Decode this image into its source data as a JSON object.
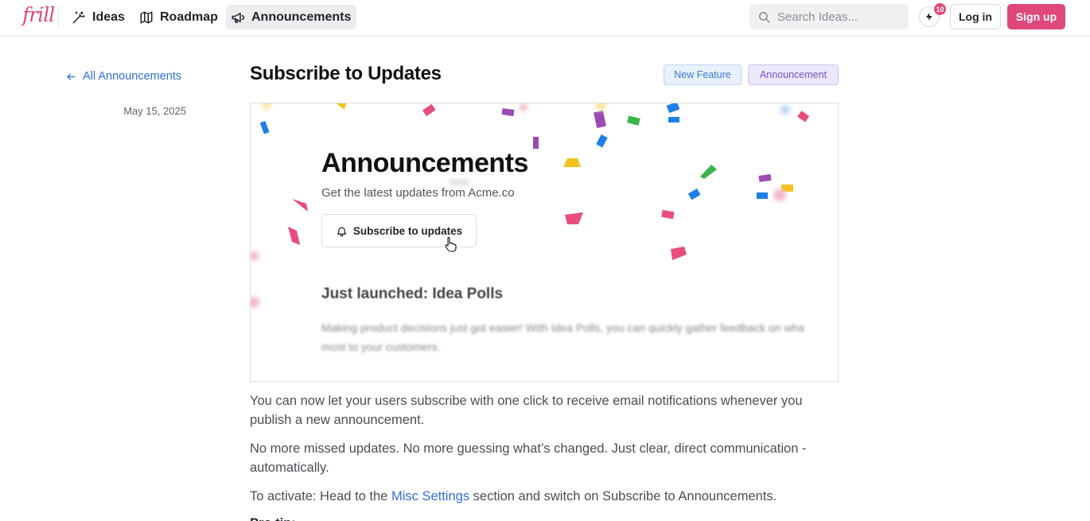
{
  "brand": {
    "logo_text": "frill",
    "accent_color": "#e0477a",
    "link_color": "#2f6fdb"
  },
  "nav": {
    "items": [
      {
        "label": "Ideas",
        "icon": "magic-wand-icon"
      },
      {
        "label": "Roadmap",
        "icon": "map-icon"
      },
      {
        "label": "Announcements",
        "icon": "megaphone-icon",
        "active": true
      }
    ]
  },
  "search": {
    "placeholder": "Search Ideas..."
  },
  "notifications": {
    "count": "10",
    "icon": "lightning-icon"
  },
  "auth": {
    "login_label": "Log in",
    "signup_label": "Sign up"
  },
  "sidebar": {
    "back_label": "All Announcements",
    "date": "May 15, 2025"
  },
  "post": {
    "title": "Subscribe to Updates",
    "tags": [
      {
        "label": "New Feature",
        "color": "#3d7cd1"
      },
      {
        "label": "Announcement",
        "color": "#7654c9"
      }
    ],
    "hero": {
      "title": "Announcements",
      "subtitle": "Get the latest updates from Acme.co",
      "button_label": "Subscribe to updates",
      "section_title": "Just launched: Idea Polls",
      "section_text_1": "Making product decisions just got easier! With Idea Polls, you can quickly gather feedback on wha",
      "section_text_2": "most to your customers."
    },
    "paragraph_1": "You can now let your users subscribe with one click to receive email notifications whenever you publish a new announcement.",
    "paragraph_2": "No more missed updates. No more guessing what’s changed. Just clear, direct communication - automatically.",
    "paragraph_3_prefix": "To activate: Head to the ",
    "paragraph_3_link": "Misc Settings",
    "paragraph_3_suffix": " section and switch on Subscribe to Announcements.",
    "paragraph_4": "Pro tip:"
  }
}
